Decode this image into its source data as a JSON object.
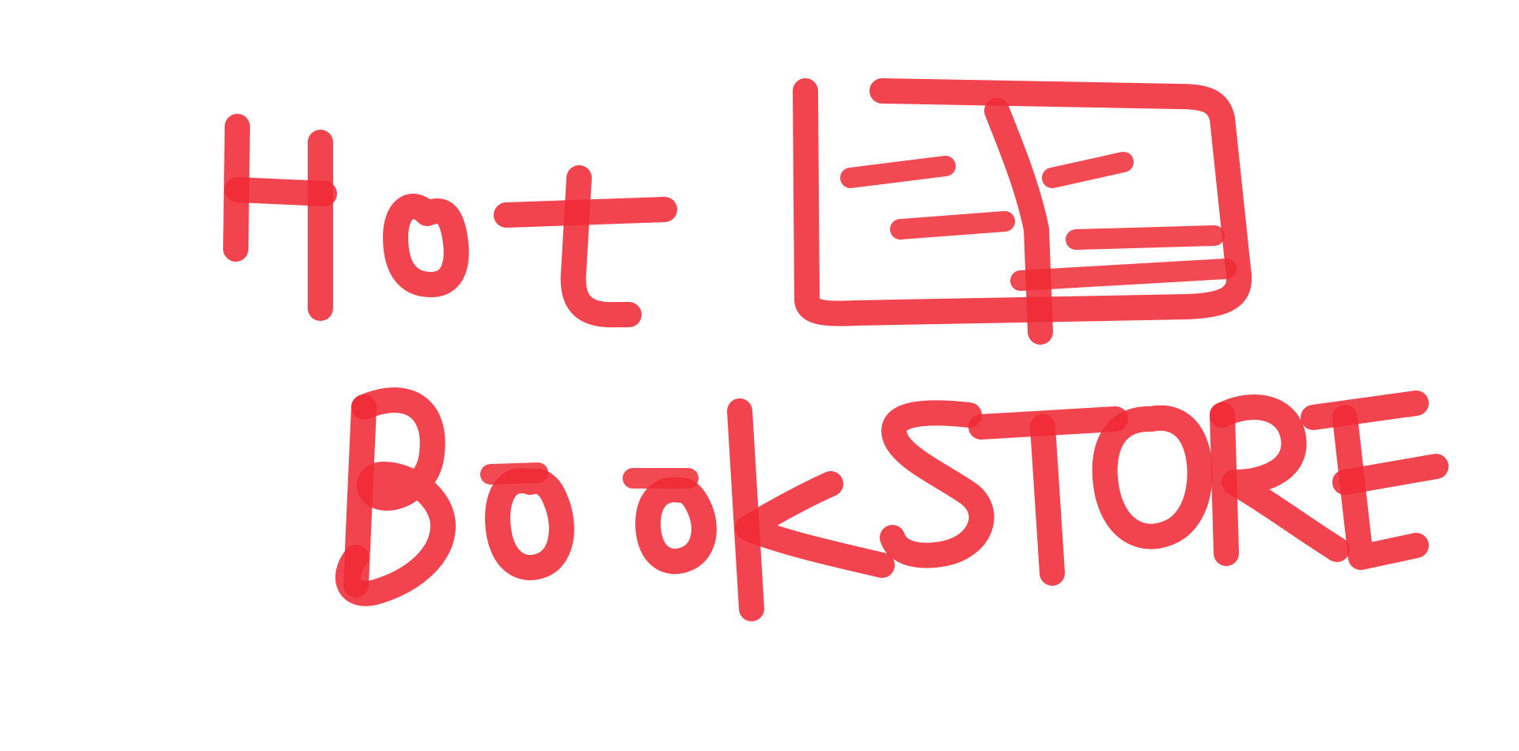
{
  "drawing": {
    "line1": "Hot",
    "line2": "BookSTORE",
    "icon": "open-book-icon",
    "stroke_color": "#ef2a35",
    "background_color": "#ffffff"
  }
}
